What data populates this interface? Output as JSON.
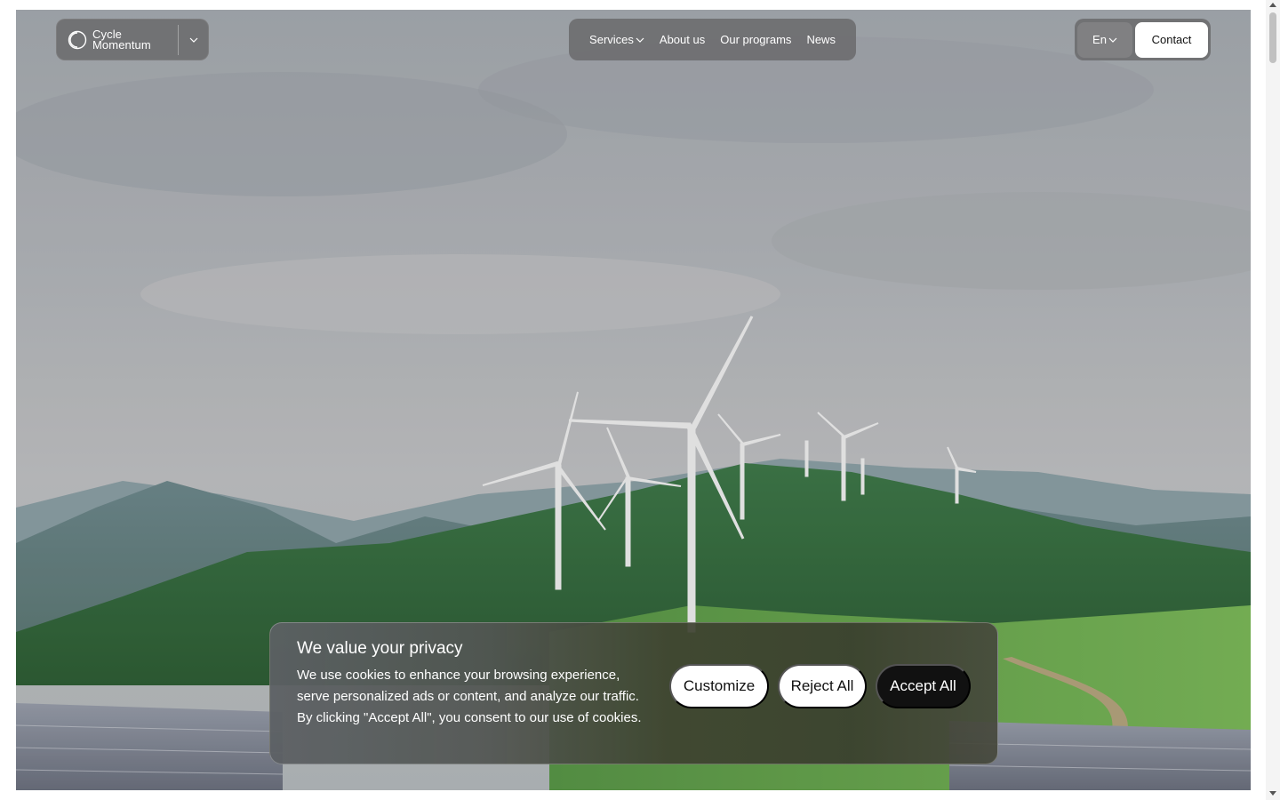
{
  "brand": {
    "name_line1": "Cycle",
    "name_line2": "Momentum"
  },
  "nav": {
    "items": [
      {
        "label": "Services"
      },
      {
        "label": "About us"
      },
      {
        "label": "Our programs"
      },
      {
        "label": "News"
      }
    ]
  },
  "header": {
    "language": "En",
    "contact_label": "Contact"
  },
  "cookie_banner": {
    "title": "We value your privacy",
    "text": "We use cookies to enhance your browsing experience, serve personalized ads or content, and analyze our traffic. By clicking \"Accept All\", you consent to our use of cookies.",
    "customize_label": "Customize",
    "reject_label": "Reject All",
    "accept_label": "Accept All"
  },
  "colors": {
    "accept_button": "#111111",
    "pill_background": "#6e6e70",
    "text_light": "#ffffff"
  }
}
